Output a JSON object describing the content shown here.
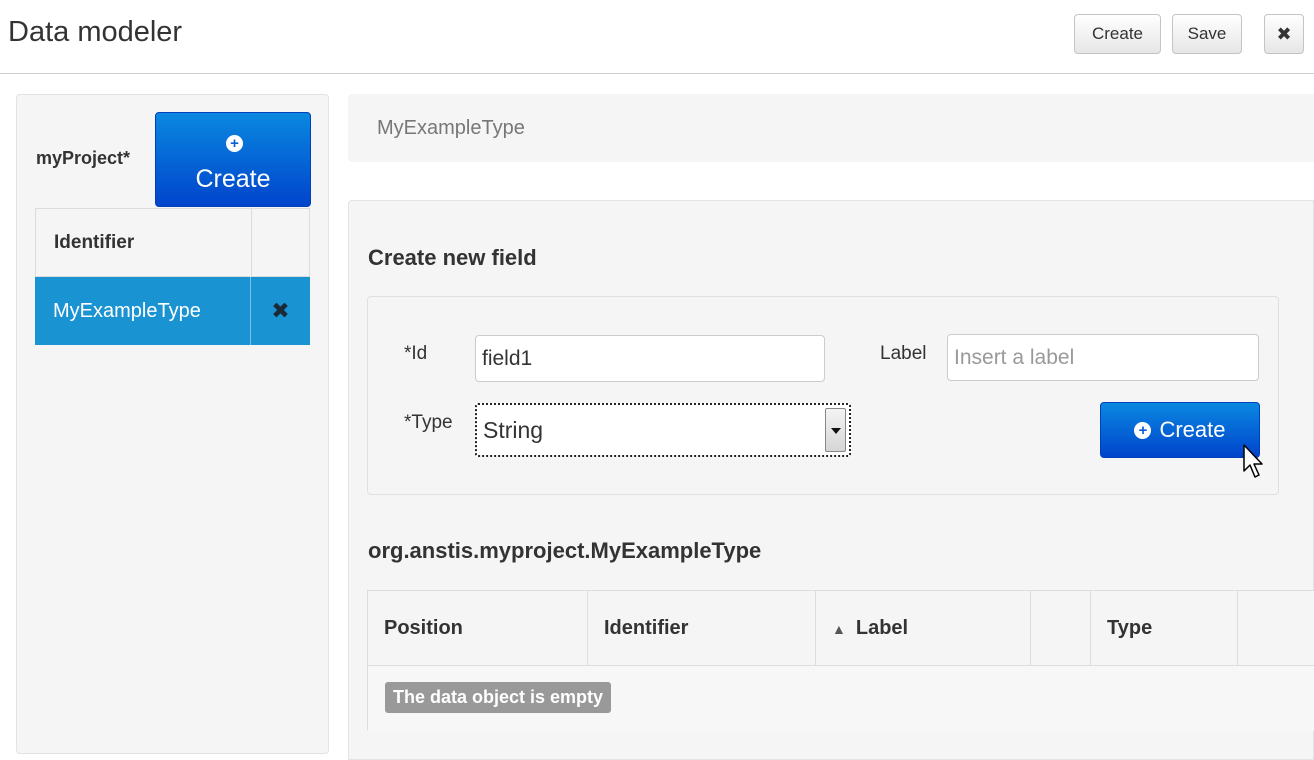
{
  "header": {
    "title": "Data modeler",
    "create_label": "Create",
    "save_label": "Save",
    "close_label": "✖"
  },
  "left": {
    "project_name": "myProject*",
    "create_label": "Create",
    "table": {
      "header": "Identifier",
      "rows": [
        {
          "identifier": "MyExampleType",
          "delete_icon": "✖"
        }
      ]
    }
  },
  "type_bar": {
    "name": "MyExampleType"
  },
  "form": {
    "title": "Create new field",
    "id_label": "*Id",
    "id_value": "field1",
    "label_label": "Label",
    "label_placeholder": "Insert a label",
    "type_label": "*Type",
    "type_value": "String",
    "create_label": "Create"
  },
  "object": {
    "title": "org.anstis.myproject.MyExampleType",
    "columns": [
      "Position",
      "Identifier",
      "Label",
      "",
      "Type",
      ""
    ],
    "sort_indicator": "▲",
    "empty_text": "The data object is empty"
  },
  "colors": {
    "primary": "#0a66d6",
    "selected_row": "#1a93d3",
    "panel_bg": "#f5f5f5"
  }
}
